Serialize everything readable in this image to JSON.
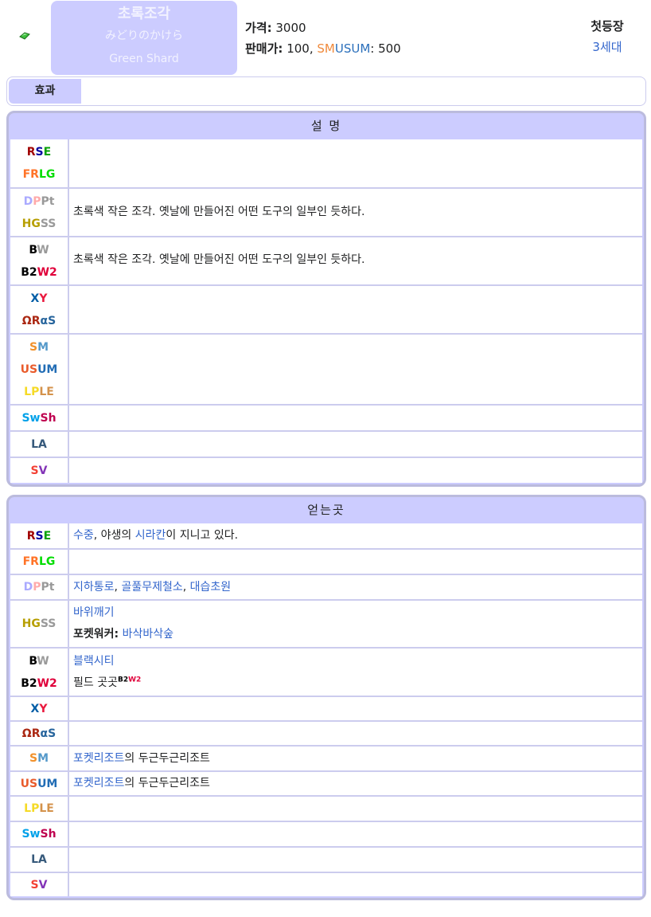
{
  "header": {
    "icon": "green-shard-icon",
    "name_ko": "초록조각",
    "name_ja": "みどりのかけら",
    "name_en": "Green Shard",
    "price_label": "가격:",
    "price_value": "3000",
    "sell_label": "판매가:",
    "sell_value": "100,",
    "sell_game_sm": "SM",
    "sell_game_usum": "USUM",
    "sell_game_value": ": 500",
    "gen_title": "첫등장",
    "gen_value": "3세대"
  },
  "effect": {
    "label": "효과"
  },
  "description": {
    "title": "설 명",
    "rows": [
      {
        "text": ""
      },
      {
        "text": "초록색 작은 조각. 옛날에 만들어진 어떤 도구의 일부인 듯하다."
      },
      {
        "text": "초록색 작은 조각. 옛날에 만들어진 어떤 도구의 일부인 듯하다."
      },
      {
        "text": ""
      },
      {
        "text": ""
      },
      {
        "text": ""
      },
      {
        "text": ""
      },
      {
        "text": ""
      }
    ]
  },
  "location": {
    "title": "얻는곳",
    "rows": [
      {
        "game": "RSE",
        "link1": "수중",
        "sep1": ", 야생의 ",
        "link2": "시라칸",
        "rest": "이 지니고 있다."
      },
      {
        "game": "FRLG"
      },
      {
        "game": "DPPt",
        "link1": "지하통로",
        "sep1": ", ",
        "link2": "골풀무제철소",
        "sep2": ", ",
        "link3": "대습초원"
      },
      {
        "game": "HGSS",
        "line1_link": "바위깨기",
        "line2_label": "포켓워커:",
        "line2_link": "바삭바삭숲"
      },
      {
        "game": "BW/B2W2",
        "line1_link": "블랙시티",
        "line2_text": "필드 곳곳",
        "sup_b2": "B2",
        "sup_w2": "W2"
      },
      {
        "game": "XY"
      },
      {
        "game": "ΩRαS"
      },
      {
        "game": "SM",
        "link1": "포켓리조트",
        "rest": "의 두근두근리조트"
      },
      {
        "game": "USUM",
        "link1": "포켓리조트",
        "rest": "의 두근두근리조트"
      },
      {
        "game": "LPLE"
      },
      {
        "game": "SwSh"
      },
      {
        "game": "LA"
      },
      {
        "game": "SV"
      }
    ]
  },
  "game_labels": {
    "rse": [
      "R",
      "S",
      "E"
    ],
    "frlg": [
      "FR",
      "LG"
    ],
    "dppt": [
      "D",
      "P",
      "Pt"
    ],
    "hgss": [
      "HG",
      "SS"
    ],
    "bw": [
      "B",
      "W"
    ],
    "b2w2": [
      "B2",
      "W2"
    ],
    "xy": [
      "X",
      "Y"
    ],
    "oras": [
      "ΩR",
      "αS"
    ],
    "sm": [
      "S",
      "M"
    ],
    "usum": [
      "US",
      "UM"
    ],
    "lple": [
      "LP",
      "LE"
    ],
    "swsh": [
      "Sw",
      "Sh"
    ],
    "la": "LA",
    "sv": [
      "S",
      "V"
    ]
  },
  "colors": {
    "panel_bg": "#ccccff",
    "link": "#3366cc",
    "r": "#a00000",
    "s": "#0000a0",
    "e": "#00a000",
    "fr": "#ff7327",
    "lg": "#00dd00",
    "d": "#aaaaff",
    "p": "#ffaaaa",
    "pt": "#999999",
    "hg": "#b69e00",
    "ss": "#999999",
    "b": "#000000",
    "w": "#999999",
    "b2": "#000000",
    "w2": "#e0003a",
    "x": "#025da6",
    "y": "#ea1a3e",
    "or": "#ab2813",
    "as": "#26649c",
    "sm_s": "#f1912b",
    "sm_m": "#5599ca",
    "us": "#e95b2b",
    "um": "#226db5",
    "lp": "#f5da26",
    "le": "#d4924b",
    "sw": "#00a1e9",
    "sh": "#bf004f",
    "la": "#36597b",
    "sv_s": "#f34134",
    "sv_v": "#8334b7"
  }
}
